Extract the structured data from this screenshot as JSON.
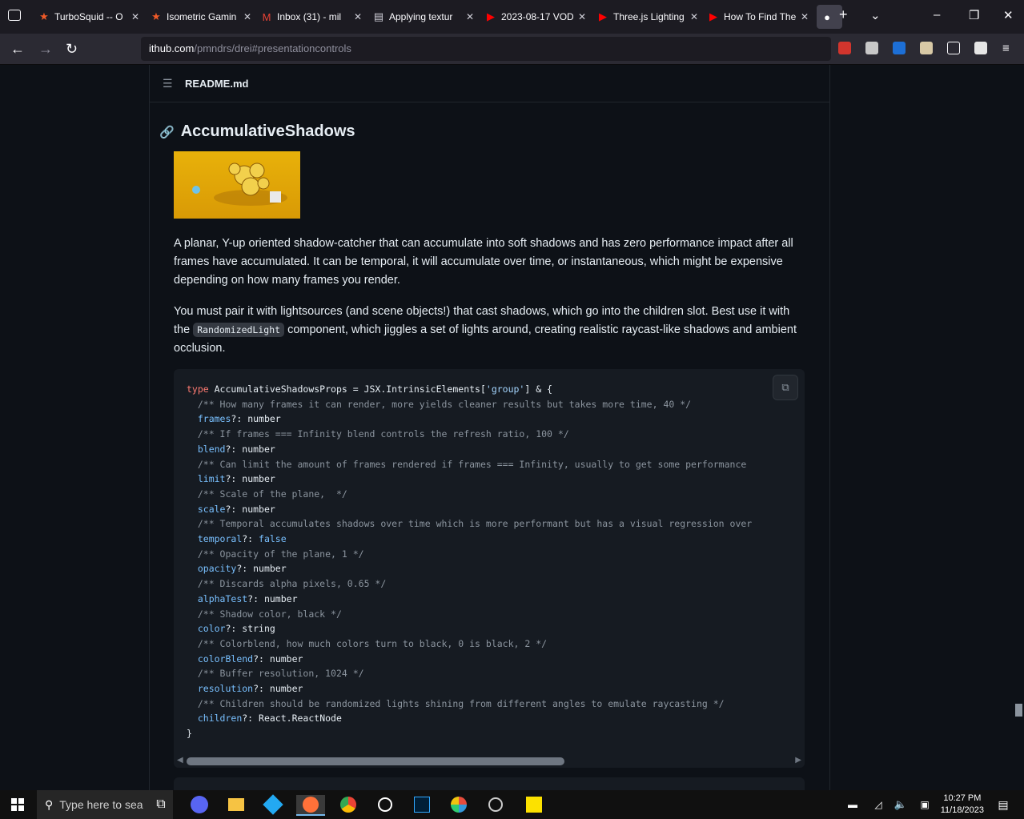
{
  "browser": {
    "tabs": [
      {
        "title": "TurboSquid -- O",
        "icon": "star-icon"
      },
      {
        "title": "Isometric Gamin",
        "icon": "star-icon"
      },
      {
        "title": "Inbox (31) - mil",
        "icon": "gmail-icon"
      },
      {
        "title": "Applying textur",
        "icon": "doc-icon"
      },
      {
        "title": "2023-08-17 VOD",
        "icon": "youtube-icon"
      },
      {
        "title": "Three.js Lighting",
        "icon": "youtube-icon"
      },
      {
        "title": "How To Find The",
        "icon": "youtube-icon"
      },
      {
        "title": "",
        "icon": "github-icon"
      }
    ],
    "url_host": "ithub.com",
    "url_path": "/pmndrs/drei#presentationcontrols"
  },
  "readme": {
    "file_name": "README.md",
    "heading": "AccumulativeShadows",
    "para1": "A planar, Y-up oriented shadow-catcher that can accumulate into soft shadows and has zero performance impact after all frames have accumulated. It can be temporal, it will accumulate over time, or instantaneous, which might be expensive depending on how many frames you render.",
    "para2_pre": "You must pair it with lightsources (and scene objects!) that cast shadows, which go into the children slot. Best use it with the ",
    "para2_code": "RandomizedLight",
    "para2_post": " component, which jiggles a set of lights around, creating realistic raycast-like shadows and ambient occlusion.",
    "code": {
      "line0_kw": "type",
      "line0_name": " AccumulativeShadowsProps = JSX.IntrinsicElements[",
      "line0_str": "'group'",
      "line0_end": "] & {",
      "fields": [
        {
          "comment": "/** How many frames it can render, more yields cleaner results but takes more time, 40 */",
          "prop": "frames",
          "type": "number"
        },
        {
          "comment": "/** If frames === Infinity blend controls the refresh ratio, 100 */",
          "prop": "blend",
          "type": "number"
        },
        {
          "comment": "/** Can limit the amount of frames rendered if frames === Infinity, usually to get some performance",
          "prop": "limit",
          "type": "number"
        },
        {
          "comment": "/** Scale of the plane,  */",
          "prop": "scale",
          "type": "number"
        },
        {
          "comment": "/** Temporal accumulates shadows over time which is more performant but has a visual regression over",
          "prop": "temporal",
          "type": "false"
        },
        {
          "comment": "/** Opacity of the plane, 1 */",
          "prop": "opacity",
          "type": "number"
        },
        {
          "comment": "/** Discards alpha pixels, 0.65 */",
          "prop": "alphaTest",
          "type": "number"
        },
        {
          "comment": "/** Shadow color, black */",
          "prop": "color",
          "type": "string"
        },
        {
          "comment": "/** Colorblend, how much colors turn to black, 0 is black, 2 */",
          "prop": "colorBlend",
          "type": "number"
        },
        {
          "comment": "/** Buffer resolution, 1024 */",
          "prop": "resolution",
          "type": "number"
        },
        {
          "comment": "/** Children should be randomized lights shining from different angles to emulate raycasting */",
          "prop": "children",
          "type": "React.ReactNode"
        }
      ],
      "closing": "}"
    }
  },
  "taskbar": {
    "search_placeholder": "Type here to sea",
    "time": "10:27 PM",
    "date": "11/18/2023"
  }
}
